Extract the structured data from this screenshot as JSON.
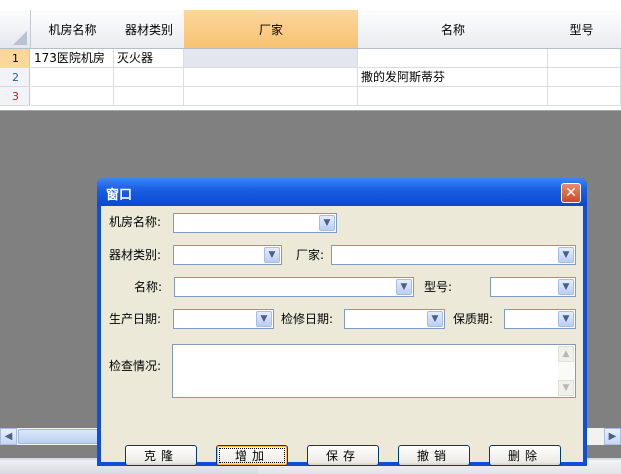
{
  "grid": {
    "columns": [
      "机房名称",
      "器材类别",
      "厂家",
      "名称",
      "型号"
    ],
    "rows": [
      {
        "num": "1",
        "cells": [
          "173医院机房",
          "灭火器",
          "",
          "",
          ""
        ]
      },
      {
        "num": "2",
        "cells": [
          "",
          "",
          "",
          "撒的发阿斯蒂芬",
          ""
        ]
      },
      {
        "num": "3",
        "cells": [
          "",
          "",
          "",
          "",
          ""
        ]
      }
    ]
  },
  "dialog": {
    "title": "窗口",
    "fields": {
      "room": "机房名称:",
      "category": "器材类别:",
      "maker": "厂家:",
      "name": "名称:",
      "model": "型号:",
      "prod_date": "生产日期:",
      "check_date": "检修日期:",
      "warranty": "保质期:",
      "inspection": "检查情况:"
    },
    "buttons": [
      "克隆",
      "增加",
      "保存",
      "撤销",
      "删除"
    ]
  },
  "icons": [
    "close-icon",
    "dropdown-arrow-icon",
    "scroll-left-icon",
    "scroll-right-icon",
    "scroll-up-icon",
    "scroll-down-icon"
  ]
}
